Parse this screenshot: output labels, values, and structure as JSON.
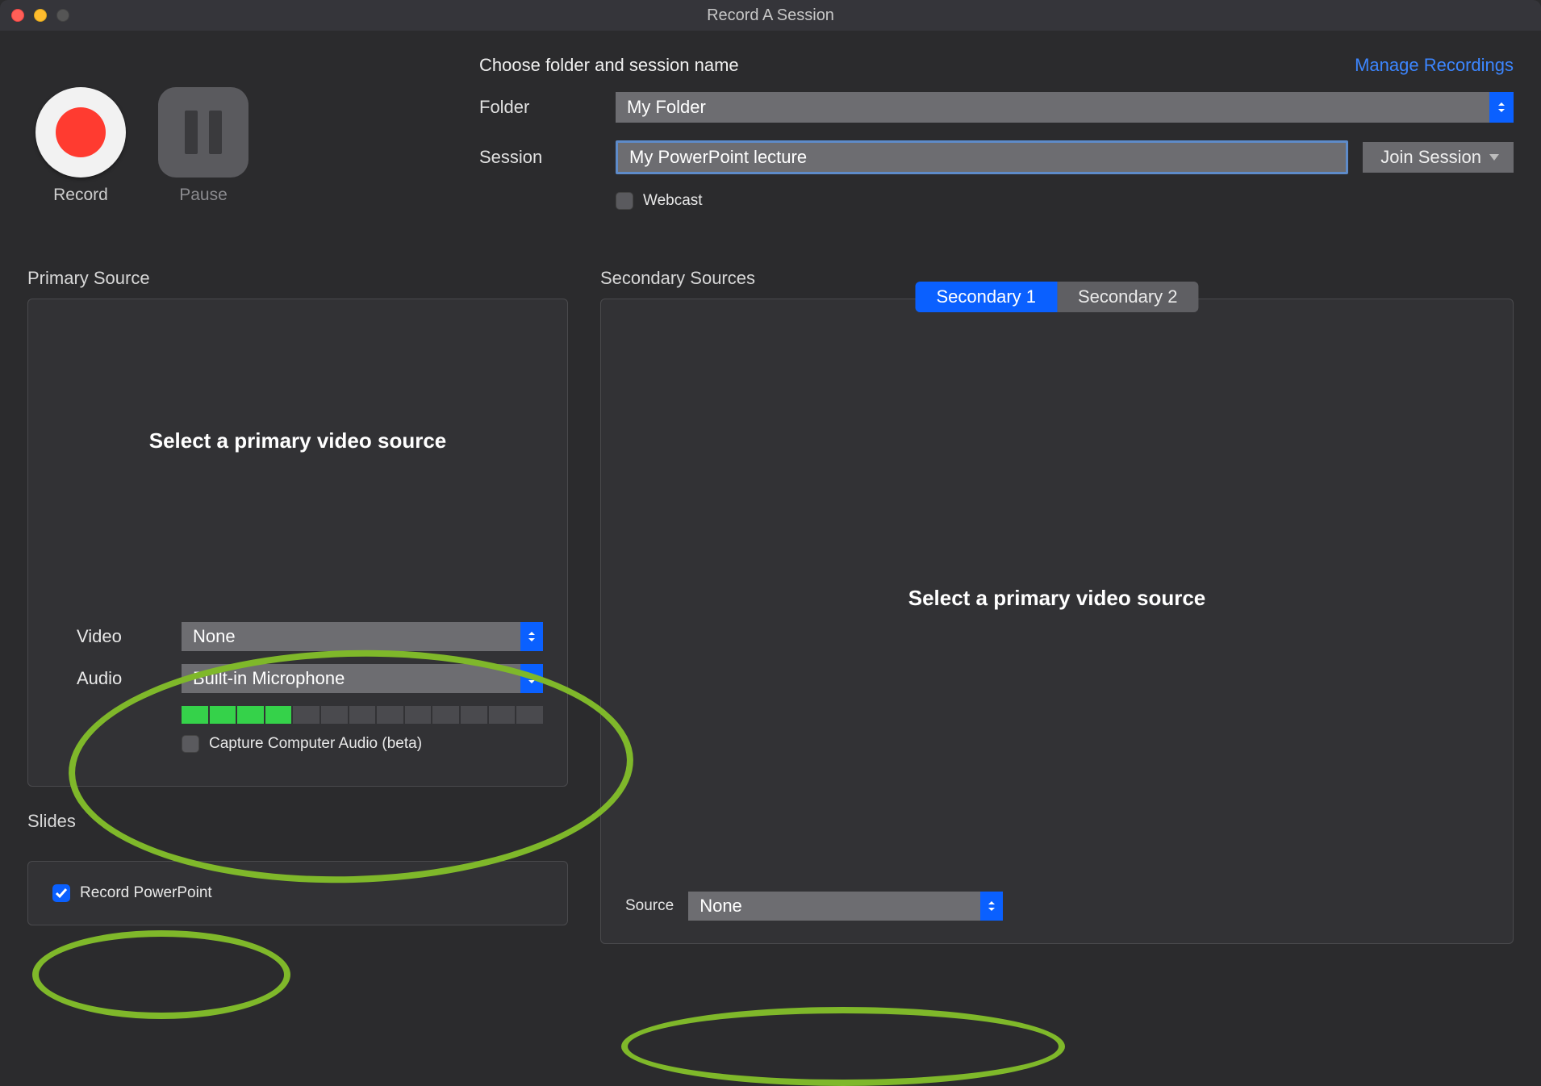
{
  "window": {
    "title": "Record A Session"
  },
  "controls": {
    "record": "Record",
    "pause": "Pause"
  },
  "form": {
    "header": "Choose folder and session name",
    "manage_link": "Manage Recordings",
    "folder_label": "Folder",
    "folder_value": "My Folder",
    "session_label": "Session",
    "session_value": "My PowerPoint lecture",
    "join_label": "Join Session",
    "webcast_label": "Webcast"
  },
  "primary": {
    "title": "Primary Source",
    "prompt": "Select a primary video source",
    "video_label": "Video",
    "video_value": "None",
    "audio_label": "Audio",
    "audio_value": "Built-in Microphone",
    "meter_level": 4,
    "meter_total": 13,
    "cca_label": "Capture Computer Audio (beta)"
  },
  "slides": {
    "title": "Slides",
    "record_ppt_label": "Record PowerPoint",
    "record_ppt_checked": true
  },
  "secondary": {
    "title": "Secondary Sources",
    "tab1": "Secondary 1",
    "tab2": "Secondary 2",
    "prompt": "Select a primary video source",
    "source_label": "Source",
    "source_value": "None"
  }
}
